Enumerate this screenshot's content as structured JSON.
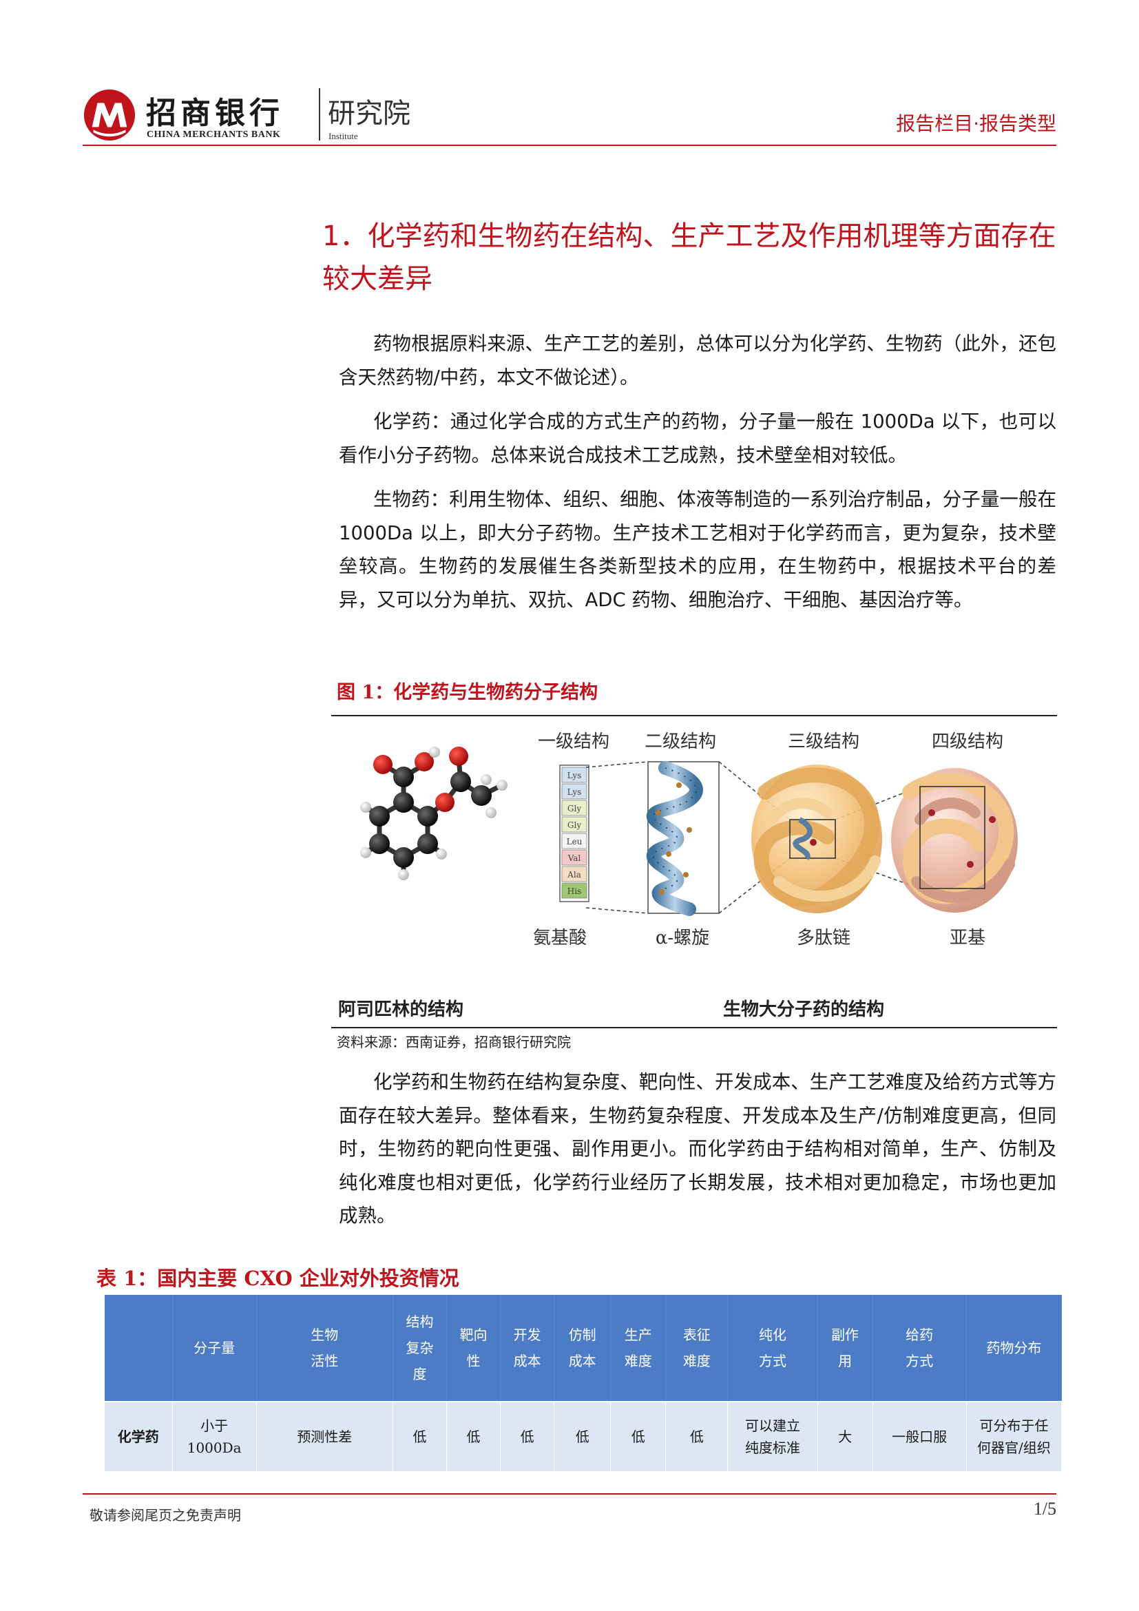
{
  "header": {
    "brand_cn": "招商银行",
    "brand_en": "CHINA MERCHANTS BANK",
    "institute_cn": "研究院",
    "institute_en": "Institute",
    "column_tag": "报告栏目·报告类型",
    "brand_color": "#c0141c"
  },
  "section": {
    "title": "1．化学药和生物药在结构、生产工艺及作用机理等方面存在较大差异"
  },
  "paragraphs": [
    "药物根据原料来源、生产工艺的差别，总体可以分为化学药、生物药（此外，还包含天然药物/中药，本文不做论述）。",
    "化学药：通过化学合成的方式生产的药物，分子量一般在 1000Da 以下，也可以看作小分子药物。总体来说合成技术工艺成熟，技术壁垒相对较低。",
    "生物药：利用生物体、组织、细胞、体液等制造的一系列治疗制品，分子量一般在 1000Da 以上，即大分子药物。生产技术工艺相对于化学药而言，更为复杂，技术壁垒较高。生物药的发展催生各类新型技术的应用，在生物药中，根据技术平台的差异，又可以分为单抗、双抗、ADC 药物、细胞治疗、干细胞、基因治疗等。",
    "化学药和生物药在结构复杂度、靶向性、开发成本、生产工艺难度及给药方式等方面存在较大差异。整体看来，生物药复杂程度、开发成本及生产/仿制难度更高，但同时，生物药的靶向性更强、副作用更小。而化学药由于结构相对简单，生产、仿制及纯化难度也相对更低，化学药行业经历了长期发展，技术相对更加稳定，市场也更加成熟。"
  ],
  "figure": {
    "title": "图 1：化学药与生物药分子结构",
    "levels": [
      "一级结构",
      "二级结构",
      "三级结构",
      "四级结构"
    ],
    "amino_acids": [
      "Lys",
      "Lys",
      "Gly",
      "Gly",
      "Leu",
      "Val",
      "Ala",
      "His"
    ],
    "amino_colors": [
      "#cfe0ee",
      "#cfe0ee",
      "#e9efc8",
      "#e9efc8",
      "#f3f3f3",
      "#f2c9c4",
      "#f6dcc0",
      "#9cc86f"
    ],
    "sublabels": [
      "氨基酸",
      "α-螺旋",
      "多肽链",
      "亚基"
    ],
    "caption_left": "阿司匹林的结构",
    "caption_right": "生物大分子药的结构",
    "source": "资料来源：西南证券，招商银行研究院"
  },
  "table": {
    "title": "表 1：国内主要 CXO 企业对外投资情况",
    "header_color": "#4d7cc7",
    "row_color": "#dde6f3",
    "headers": [
      "",
      "分子量",
      "生物\n活性",
      "结构\n复杂\n度",
      "靶向\n性",
      "开发\n成本",
      "仿制\n成本",
      "生产\n难度",
      "表征\n难度",
      "纯化\n方式",
      "副作\n用",
      "给药\n方式",
      "药物分布"
    ],
    "rows": [
      [
        "化学药",
        "小于\n1000Da",
        "预测性差",
        "低",
        "低",
        "低",
        "低",
        "低",
        "低",
        "可以建立\n纯度标准",
        "大",
        "一般口服",
        "可分布于任\n何器官/组织"
      ]
    ]
  },
  "footer": {
    "note": "敬请参阅尾页之免责声明",
    "page": "1/5"
  }
}
